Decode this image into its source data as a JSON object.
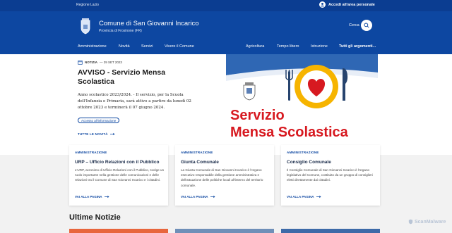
{
  "topbar": {
    "region": "Regione Lazio",
    "login_label": "Accedi all'area personale"
  },
  "header": {
    "title": "Comune di San Giovanni Incarico",
    "subtitle": "Provincia di Frosinone (FR)",
    "search_label": "Cerca"
  },
  "nav": {
    "left": [
      "Amministrazione",
      "Novità",
      "Servizi",
      "Vivere il Comune"
    ],
    "right": [
      "Agricoltura",
      "Tempo libero",
      "Istruzione"
    ],
    "all_topics": "Tutti gli argomenti..."
  },
  "hero": {
    "category": "NOTIZIA",
    "date": "— 29 SET 2023",
    "title": "AVVISO - Servizio Mensa Scolastica",
    "description": "Anno scolastico 2023/2024. - Il servizio, per la Scuola dell'Infanzia e Primaria, sarà attivo a partire da lunedì 02 ottobre 2023 e terminerà il 07 giugno 2024.",
    "chip": "Accesso all'informazione",
    "all_news": "TUTTE LE NOVITÀ",
    "image_text_line1": "Servizio",
    "image_text_line2": "Mensa Scolastica"
  },
  "cards": [
    {
      "category": "AMMINISTRAZIONE",
      "title": "URP – Ufficio Relazioni con il Pubblico",
      "text": "L'URP, acronimo di Ufficio Relazioni con il Pubblico, svolge un ruolo importante nella gestione delle comunicazioni e delle relazioni tra il Comune di San Giovanni Incarico e i cittadini.",
      "link": "VAI ALLA PAGINA"
    },
    {
      "category": "AMMINISTRAZIONE",
      "title": "Giunta Comunale",
      "text": "La Giunta Comunale di San Giovanni Incarico è l'organo esecutivo responsabile della gestione amministrativa e dell'attuazione delle politiche locali all'interno del territorio comunale.",
      "link": "VAI ALLA PAGINA"
    },
    {
      "category": "AMMINISTRAZIONE",
      "title": "Consiglio Comunale",
      "text": "Il Consiglio Comunale di San Giovanni Incarico è l'organo legislativo del Comune, costituito da un gruppo di consiglieri eletti direttamente dai cittadini.",
      "link": "VAI ALLA PAGINA"
    }
  ],
  "latest_news_title": "Ultime Notizie",
  "watermark": "ScanMalware",
  "colors": {
    "primary": "#0d47a1",
    "topbar": "#0b3d91",
    "accent_red": "#d71920",
    "plate_yellow": "#f6b400"
  }
}
